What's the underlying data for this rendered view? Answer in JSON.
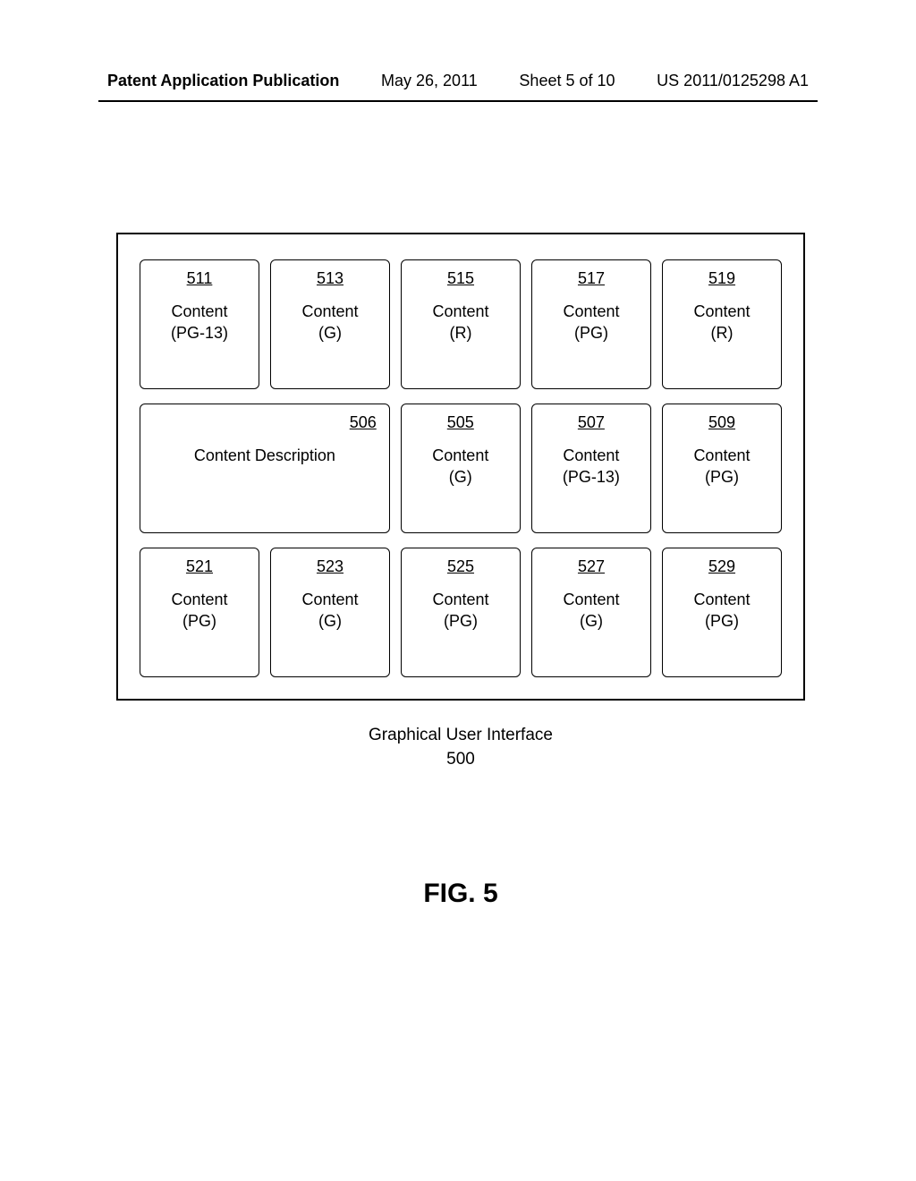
{
  "header": {
    "publication_label": "Patent Application Publication",
    "date": "May 26, 2011",
    "sheet": "Sheet 5 of 10",
    "pub_number": "US 2011/0125298 A1"
  },
  "rows": [
    {
      "tiles": [
        {
          "ref": "511",
          "line1": "Content",
          "line2": "(PG-13)",
          "wide": false
        },
        {
          "ref": "513",
          "line1": "Content",
          "line2": "(G)",
          "wide": false
        },
        {
          "ref": "515",
          "line1": "Content",
          "line2": "(R)",
          "wide": false
        },
        {
          "ref": "517",
          "line1": "Content",
          "line2": "(PG)",
          "wide": false
        },
        {
          "ref": "519",
          "line1": "Content",
          "line2": "(R)",
          "wide": false
        }
      ]
    },
    {
      "tiles": [
        {
          "ref": "506",
          "line1": "Content Description",
          "line2": "",
          "wide": true
        },
        {
          "ref": "505",
          "line1": "Content",
          "line2": "(G)",
          "wide": false
        },
        {
          "ref": "507",
          "line1": "Content",
          "line2": "(PG-13)",
          "wide": false
        },
        {
          "ref": "509",
          "line1": "Content",
          "line2": "(PG)",
          "wide": false
        }
      ]
    },
    {
      "tiles": [
        {
          "ref": "521",
          "line1": "Content",
          "line2": "(PG)",
          "wide": false
        },
        {
          "ref": "523",
          "line1": "Content",
          "line2": "(G)",
          "wide": false
        },
        {
          "ref": "525",
          "line1": "Content",
          "line2": "(PG)",
          "wide": false
        },
        {
          "ref": "527",
          "line1": "Content",
          "line2": "(G)",
          "wide": false
        },
        {
          "ref": "529",
          "line1": "Content",
          "line2": "(PG)",
          "wide": false
        }
      ]
    }
  ],
  "caption": {
    "line1": "Graphical User Interface",
    "line2": "500"
  },
  "figure_label": "FIG. 5"
}
